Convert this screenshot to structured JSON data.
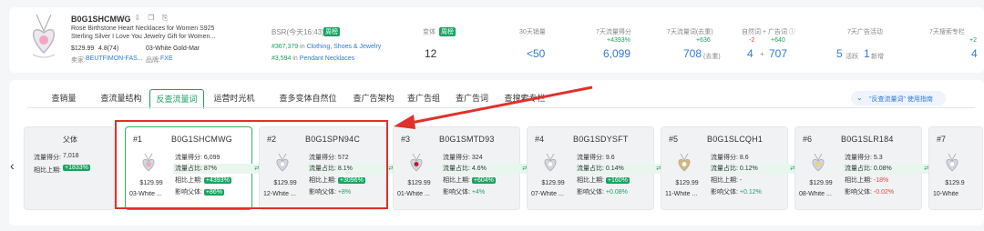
{
  "product": {
    "asin": "B0G1SHCMWG",
    "title_line1": "Rose Birthstone Heart Necklaces for Women S925",
    "title_line2": "Sterling Silver I Love You Jewelry Gift for Women...",
    "price": "$129.99",
    "rating": "4.8(74)",
    "variant": "03-White Gold-Mar",
    "seller_label": "卖家:",
    "seller": "BEUTFIMON-FAS...",
    "brand_label": "品牌:",
    "brand": "FXE"
  },
  "bsr": {
    "label": "BSR(今天16:43)",
    "badge": "周榜",
    "rank1": "#367,379",
    "in1": "in",
    "cat1": "Clothing, Shoes & Jewelry",
    "rank2": "#3,594",
    "in2": "in",
    "cat2": "Pendant Necklaces"
  },
  "metrics": [
    {
      "label": "变体",
      "badge": "周榜",
      "value": "12"
    },
    {
      "label": "30天销量",
      "value": "<50"
    },
    {
      "label": "7天流量得分",
      "delta": "+4393%",
      "value": "6,099"
    },
    {
      "label": "7天流量词(去重)",
      "delta": "+636",
      "value": "708",
      "suffix": "(去重)"
    },
    {
      "label": "自然词 + 广告词 ⓘ",
      "delta_a": "-2",
      "delta_b": "+640",
      "value_a": "4",
      "value_b": "707"
    },
    {
      "label": "7天广告活动",
      "value_a": "5",
      "sub_a": "活跃",
      "value_b": "1",
      "sub_b": "新增"
    },
    {
      "label": "7天搜索专栏",
      "delta": "+2",
      "value": "4"
    }
  ],
  "tabs": [
    "查销量",
    "查流量结构",
    "反查流量词",
    "运营时光机",
    "查多变体自然位",
    "查广告架构",
    "查广告组",
    "查广告词",
    "查搜索专栏"
  ],
  "guide": "\"反查流量词\" 使用指南",
  "parent": {
    "title": "父体",
    "score_label": "流量得分:",
    "score": "7,018",
    "compare_label": "相比上期:",
    "compare": "+1833%"
  },
  "variants": [
    {
      "idx": "#1",
      "asin": "B0G1SHCMWG",
      "price": "$129.99",
      "name": "03-White ...",
      "score": "6,099",
      "share": "87%",
      "compare": "+4393%",
      "impact": "+86%",
      "impact_style": "badge"
    },
    {
      "idx": "#2",
      "asin": "B0G1SPN94C",
      "price": "$129.99",
      "name": "12-White ...",
      "score": "572",
      "share": "8.1%",
      "compare": "+3096%",
      "impact": "+8%",
      "impact_style": "green"
    },
    {
      "idx": "#3",
      "asin": "B0G1SMTD93",
      "price": "$129.99",
      "name": "01-White ...",
      "score": "324",
      "share": "4.6%",
      "compare": "+604%",
      "impact": "+4%",
      "impact_style": "green"
    },
    {
      "idx": "#4",
      "asin": "B0G1SDYSFT",
      "price": "$129.99",
      "name": "07-White ...",
      "score": "9.6",
      "share": "0.14%",
      "compare": "+160%",
      "impact": "+0.08%",
      "impact_style": "green"
    },
    {
      "idx": "#5",
      "asin": "B0G1SLCQH1",
      "price": "$129.99",
      "name": "11-White ...",
      "score": "8.6",
      "share": "0.12%",
      "compare": "-",
      "impact": "+0.12%",
      "impact_style": "green"
    },
    {
      "idx": "#6",
      "asin": "B0G1SLR184",
      "price": "$129.99",
      "name": "08-White ...",
      "score": "5.3",
      "share": "0.08%",
      "compare": "-18%",
      "impact": "-0.02%",
      "impact_style": "red"
    },
    {
      "idx": "#7",
      "asin": "",
      "price": "$129.9",
      "name": "10-White",
      "score": "",
      "share": "",
      "compare": "",
      "impact": "",
      "impact_style": "green"
    }
  ],
  "labels": {
    "score": "流量得分:",
    "share": "流量占比:",
    "compare": "相比上期:",
    "impact": "影响父体:"
  },
  "colors": {
    "accent": "#1aa260",
    "link": "#2f7bd8",
    "highlight_box": "#e0312b"
  }
}
